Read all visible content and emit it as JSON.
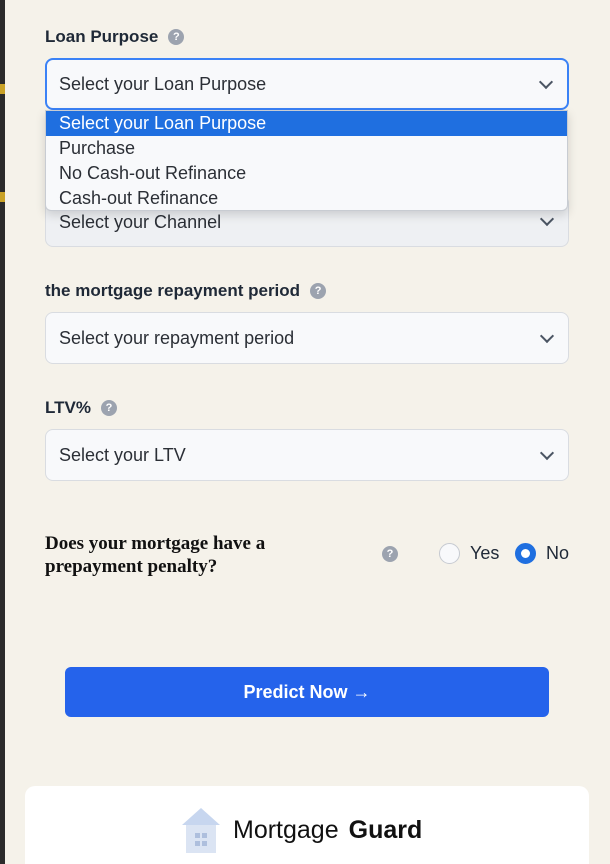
{
  "loan_purpose": {
    "label": "Loan Purpose",
    "selected": "Select your Loan Purpose",
    "options": [
      "Select your Loan Purpose",
      "Purchase",
      "No Cash-out Refinance",
      "Cash-out Refinance"
    ]
  },
  "channel": {
    "selected": "Select your Channel"
  },
  "repayment": {
    "label": "the mortgage repayment period",
    "selected": "Select your repayment period"
  },
  "ltv": {
    "label": "LTV%",
    "selected": "Select your LTV"
  },
  "prepayment": {
    "question": "Does your mortgage have a prepayment penalty?",
    "yes_label": "Yes",
    "no_label": "No",
    "selected": "No"
  },
  "predict_button": "Predict Now →",
  "brand": {
    "name_regular": "Mortgage",
    "name_bold": "Guard"
  },
  "colors": {
    "accent": "#2563eb",
    "focus": "#3b82f6",
    "background": "#f5f2ea"
  },
  "help_glyph": "?"
}
